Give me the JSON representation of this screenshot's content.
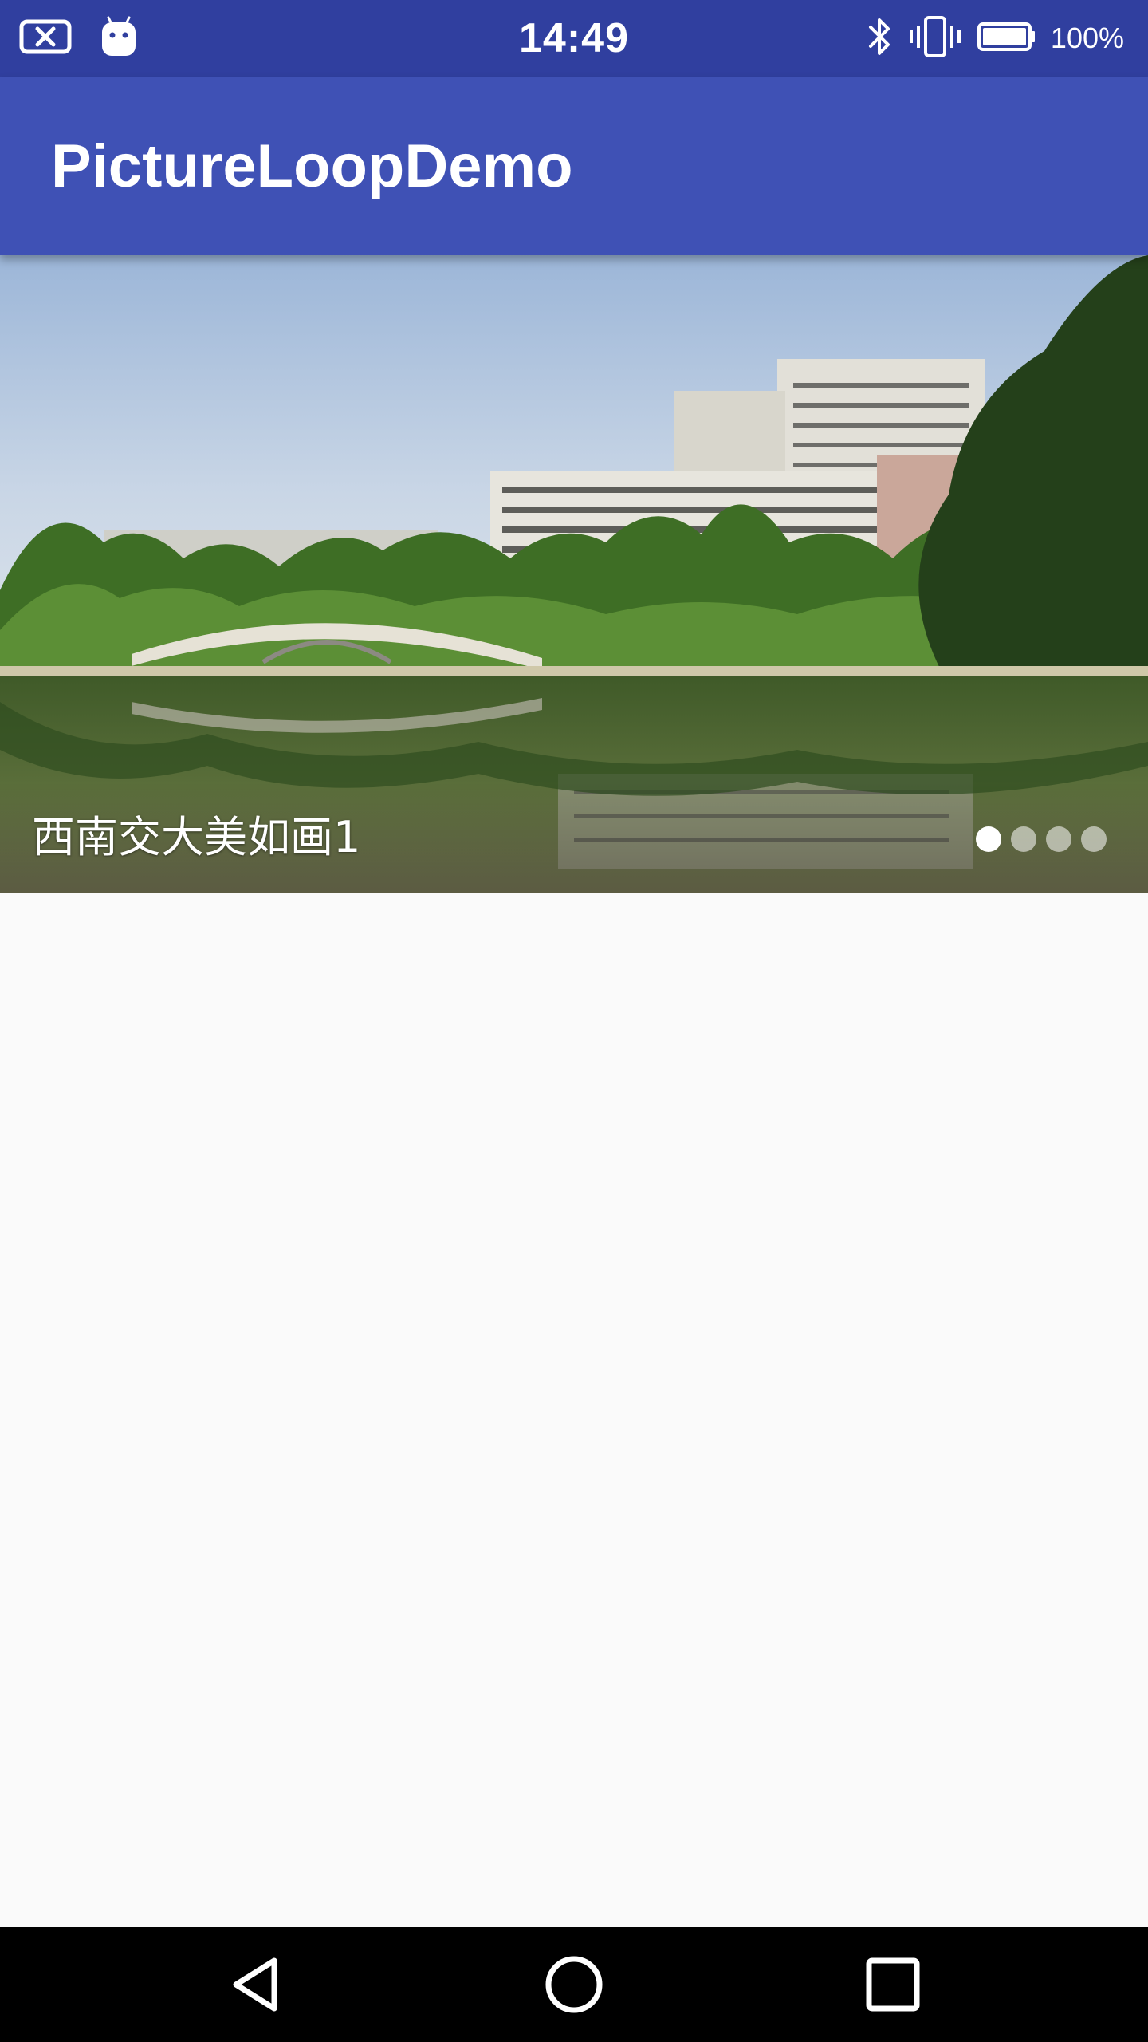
{
  "status_bar": {
    "time": "14:49",
    "battery_percent": "100%",
    "icons": [
      "notification-x-icon",
      "android-icon",
      "bluetooth-icon",
      "vibrate-icon",
      "battery-icon"
    ]
  },
  "app_bar": {
    "title": "PictureLoopDemo"
  },
  "carousel": {
    "caption": "西南交大美如画1",
    "page_count": 4,
    "active_index": 0
  },
  "nav_bar": {
    "icons": [
      "back-icon",
      "home-icon",
      "recents-icon"
    ]
  },
  "colors": {
    "status_bar": "#303f9f",
    "app_bar": "#3f51b5",
    "background": "#fafafa",
    "nav_bar": "#000000"
  }
}
